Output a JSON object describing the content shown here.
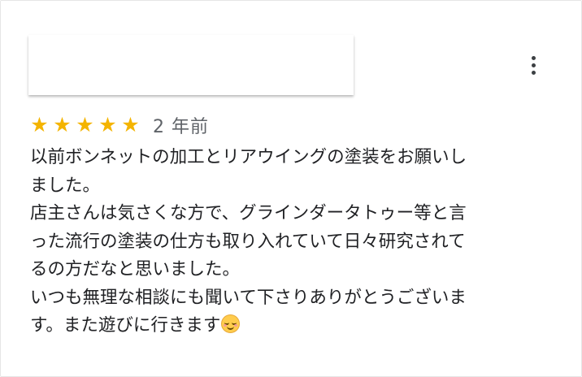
{
  "review": {
    "rating": 5,
    "rating_max": 5,
    "stars": [
      "★",
      "★",
      "★",
      "★",
      "★"
    ],
    "star_color": "#f4b400",
    "time_ago": "2 年前",
    "lines": [
      "以前ボンネットの加工とリアウイングの塗装をお願いし",
      "ました。",
      "店主さんは気さくな方で、グラインダータトゥー等と言",
      "った流行の塗装の仕方も取り入れていて日々研究されて",
      "るの方だなと思いました。",
      "いつも無理な相談にも聞いて下さりありがとうございま",
      "す。また遊びに行きます"
    ],
    "trailing_emoji": "smiling-face-icon"
  },
  "more_menu_icon": "more-vert-icon"
}
